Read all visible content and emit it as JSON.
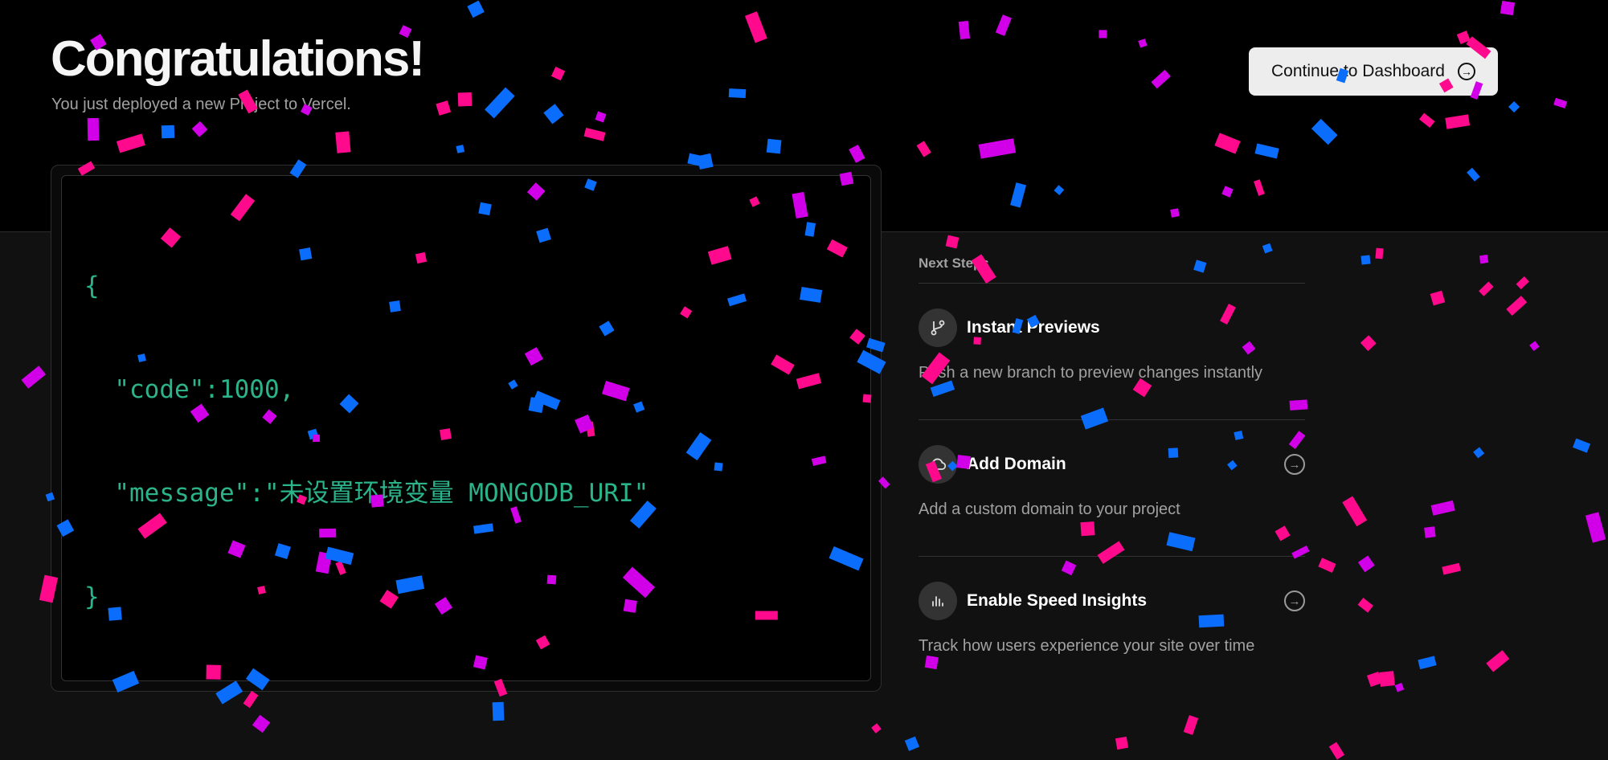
{
  "header": {
    "title": "Congratulations!",
    "subtitle": "You just deployed a new Project to Vercel.",
    "continue_label": "Continue to Dashboard",
    "continue_icon": "arrow-right-circle-icon"
  },
  "preview": {
    "code_lines": [
      "{",
      "  \"code\":1000,",
      "  \"message\":\"未设置环境变量 MONGODB_URI\"",
      "}"
    ]
  },
  "next_steps": {
    "heading": "Next Steps",
    "items": [
      {
        "title": "Instant Previews",
        "description": "Push a new branch to preview changes instantly",
        "icon": "git-branch-icon",
        "has_arrow": false
      },
      {
        "title": "Add Domain",
        "description": "Add a custom domain to your project",
        "icon": "cloud-icon",
        "has_arrow": true
      },
      {
        "title": "Enable Speed Insights",
        "description": "Track how users experience your site over time",
        "icon": "bar-chart-icon",
        "has_arrow": true
      }
    ]
  },
  "colors": {
    "confetti_pink": "#ff0a8c",
    "confetti_magenta": "#d100e8",
    "confetti_blue": "#0a6dfc",
    "code_green": "#2bb38a"
  }
}
